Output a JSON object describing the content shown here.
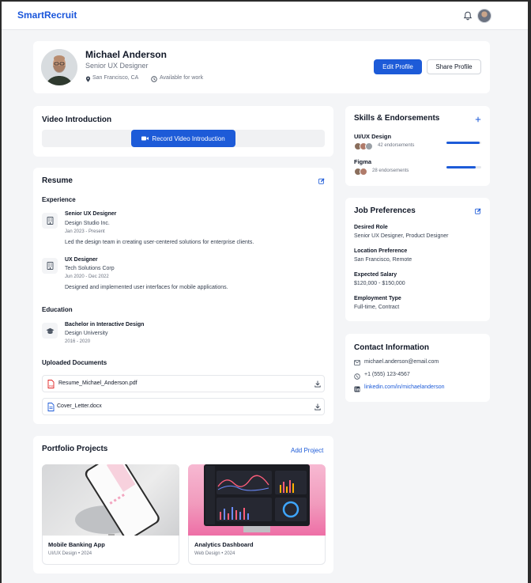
{
  "app": {
    "brand": "SmartRecruit"
  },
  "profile": {
    "name": "Michael Anderson",
    "title": "Senior UX Designer",
    "location": "San Francisco, CA",
    "availability": "Available for work",
    "edit_label": "Edit Profile",
    "share_label": "Share Profile"
  },
  "video": {
    "heading": "Video Introduction",
    "button_label": "Record Video Introduction"
  },
  "resume": {
    "heading": "Resume",
    "experience_heading": "Experience",
    "experience": [
      {
        "role": "Senior UX Designer",
        "company": "Design Studio Inc.",
        "dates": "Jan 2023 - Present",
        "description": "Led the design team in creating user-centered solutions for enterprise clients."
      },
      {
        "role": "UX Designer",
        "company": "Tech Solutions Corp",
        "dates": "Jun 2020 - Dec 2022",
        "description": "Designed and implemented user interfaces for mobile applications."
      }
    ],
    "education_heading": "Education",
    "education": [
      {
        "degree": "Bachelor in Interactive Design",
        "school": "Design University",
        "dates": "2016 - 2020"
      }
    ],
    "documents_heading": "Uploaded Documents",
    "documents": [
      {
        "name": "Resume_Michael_Anderson.pdf",
        "type": "pdf"
      },
      {
        "name": "Cover_Letter.docx",
        "type": "docx"
      }
    ]
  },
  "portfolio": {
    "heading": "Portfolio Projects",
    "add_label": "Add Project",
    "projects": [
      {
        "title": "Mobile Banking App",
        "meta": "UI/UX Design • 2024"
      },
      {
        "title": "Analytics Dashboard",
        "meta": "Web Design • 2024"
      }
    ]
  },
  "skills": {
    "heading": "Skills & Endorsements",
    "add_icon": "plus-icon",
    "items": [
      {
        "name": "UI/UX Design",
        "endorsements": "42 endorsements",
        "level": 0.95
      },
      {
        "name": "Figma",
        "endorsements": "28 endorsements",
        "level": 0.85
      }
    ]
  },
  "preferences": {
    "heading": "Job Preferences",
    "items": [
      {
        "label": "Desired Role",
        "value": "Senior UX Designer, Product Designer"
      },
      {
        "label": "Location Preference",
        "value": "San Francisco, Remote"
      },
      {
        "label": "Expected Salary",
        "value": "$120,000 - $150,000"
      },
      {
        "label": "Employment Type",
        "value": "Full-time, Contract"
      }
    ]
  },
  "contact": {
    "heading": "Contact Information",
    "email": "michael.anderson@email.com",
    "phone": "+1 (555) 123-4567",
    "linkedin": "linkedin.com/in/michaelanderson"
  },
  "colors": {
    "accent": "#1d5bd8",
    "background": "#f4f5f7",
    "card": "#ffffff"
  }
}
